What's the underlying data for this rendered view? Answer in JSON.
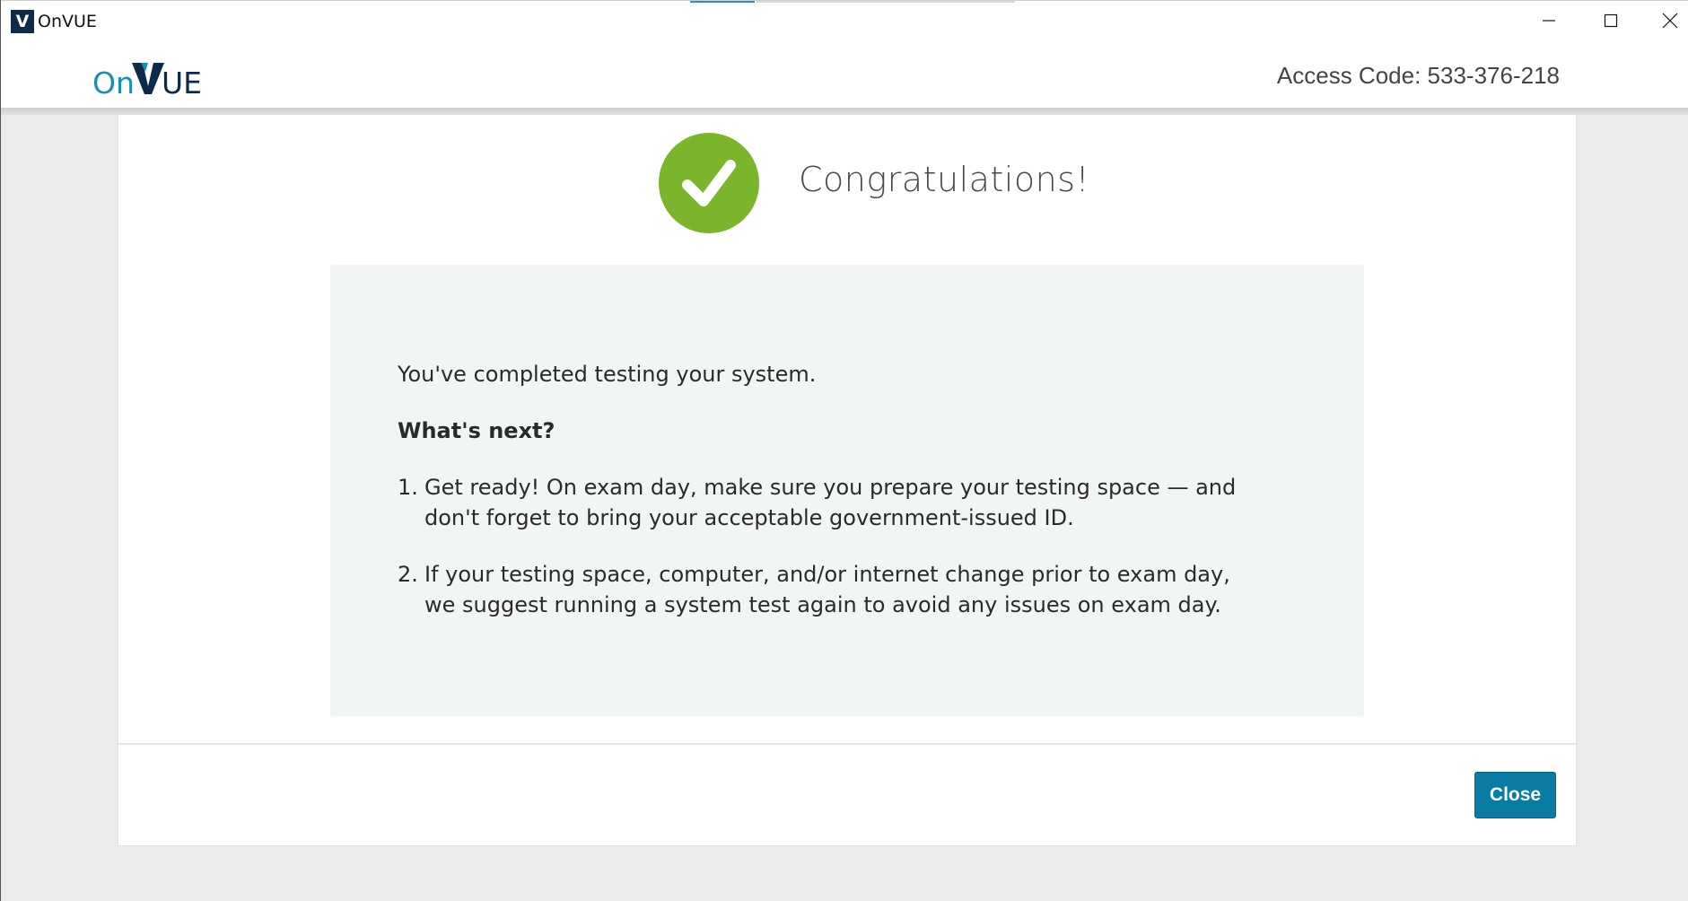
{
  "window": {
    "title": "OnVUE",
    "app_icon_letter": "V",
    "controls": [
      "minimize-icon",
      "maximize-icon",
      "close-icon"
    ]
  },
  "header": {
    "logo": {
      "prefix": "On",
      "suffix": "UE",
      "brand_colors": {
        "prefix": "#1a8fb0",
        "mark": "#0e2a4a"
      }
    },
    "access_code": "Access Code: 533-376-218"
  },
  "dialog": {
    "status_icon": "checkmark-icon",
    "status_color": "#7ab52c",
    "heading": "Congratulations!",
    "completed_text": "You've completed testing your system.",
    "next_heading": "What's next?",
    "steps": [
      {
        "number": "1.",
        "text": "Get ready! On exam day, make sure you prepare your testing space — and don't forget to bring your acceptable government-issued ID."
      },
      {
        "number": "2.",
        "text": "If your testing space, computer, and/or internet change prior to exam day, we suggest running a system test again to avoid any issues on exam day."
      }
    ],
    "close_label": "Close",
    "accent_color": "#0a7ba3"
  }
}
